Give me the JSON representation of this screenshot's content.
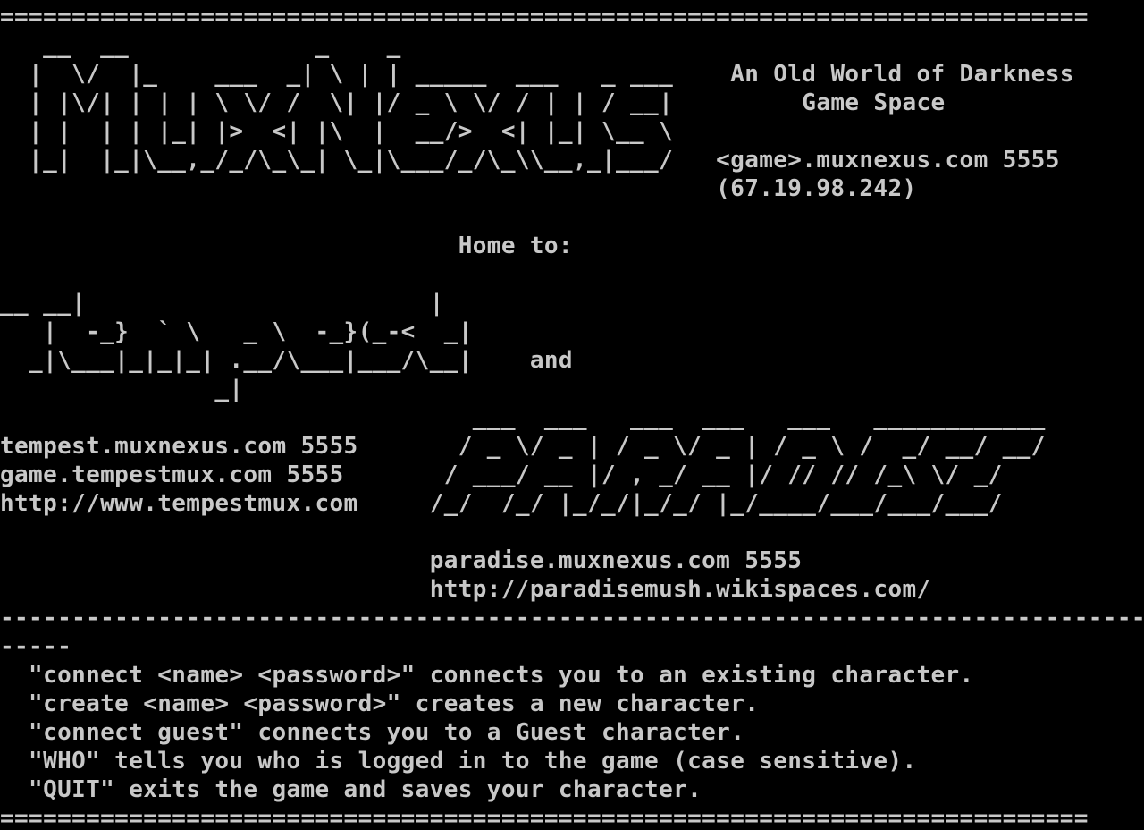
{
  "terminal": {
    "foreground": "#c8c8c8",
    "background": "#000000",
    "lines": [
      "============================================================================",
      "   __  __             _    _",
      "  |  \\/  |_    ___  _| \\ | | _____  ___   _ ___    An Old World of Darkness",
      "  | |\\/| | | | \\ \\/ /  \\| |/ _ \\ \\/ / | | / __|         Game Space",
      "  | |  | | |_| |>  <| |\\  |  __/>  <| |_| \\__ \\",
      "  |_|  |_|\\__,_/_/\\_\\_| \\_|\\___/_/\\_\\\\__,_|___/   <game>.muxnexus.com 5555",
      "                                                  (67.19.98.242)",
      "",
      "                                Home to:",
      "",
      "__ __|                        |",
      "   |  -_}  ` \\   _ \\  -_}(_-<  _|",
      "  _|\\___|_|_|_| .__/\\___|___/\\__|    and",
      "               _|",
      "                                 ___  ___   ___  ___   ___   ____________",
      "tempest.muxnexus.com 5555       / _ \\/ _ | / _ \\/ _ | / _ \\ /  _/ __/ __/",
      "game.tempestmux.com 5555       / ___/ __ |/ , _/ __ |/ // // /_\\ \\/ _/",
      "http://www.tempestmux.com     /_/  /_/ |_/_/|_/_/ |_/____/___/___/___/",
      "",
      "                              paradise.muxnexus.com 5555",
      "                              http://paradisemush.wikispaces.com/",
      "--------------------------------------------------------------------------------",
      "-----",
      "  \"connect <name> <password>\" connects you to an existing character.",
      "  \"create <name> <password>\" creates a new character.",
      "  \"connect guest\" connects you to a Guest character.",
      "  \"WHO\" tells you who is logged in to the game (case sensitive).",
      "  \"QUIT\" exits the game and saves your character.",
      "============================================================================"
    ]
  }
}
